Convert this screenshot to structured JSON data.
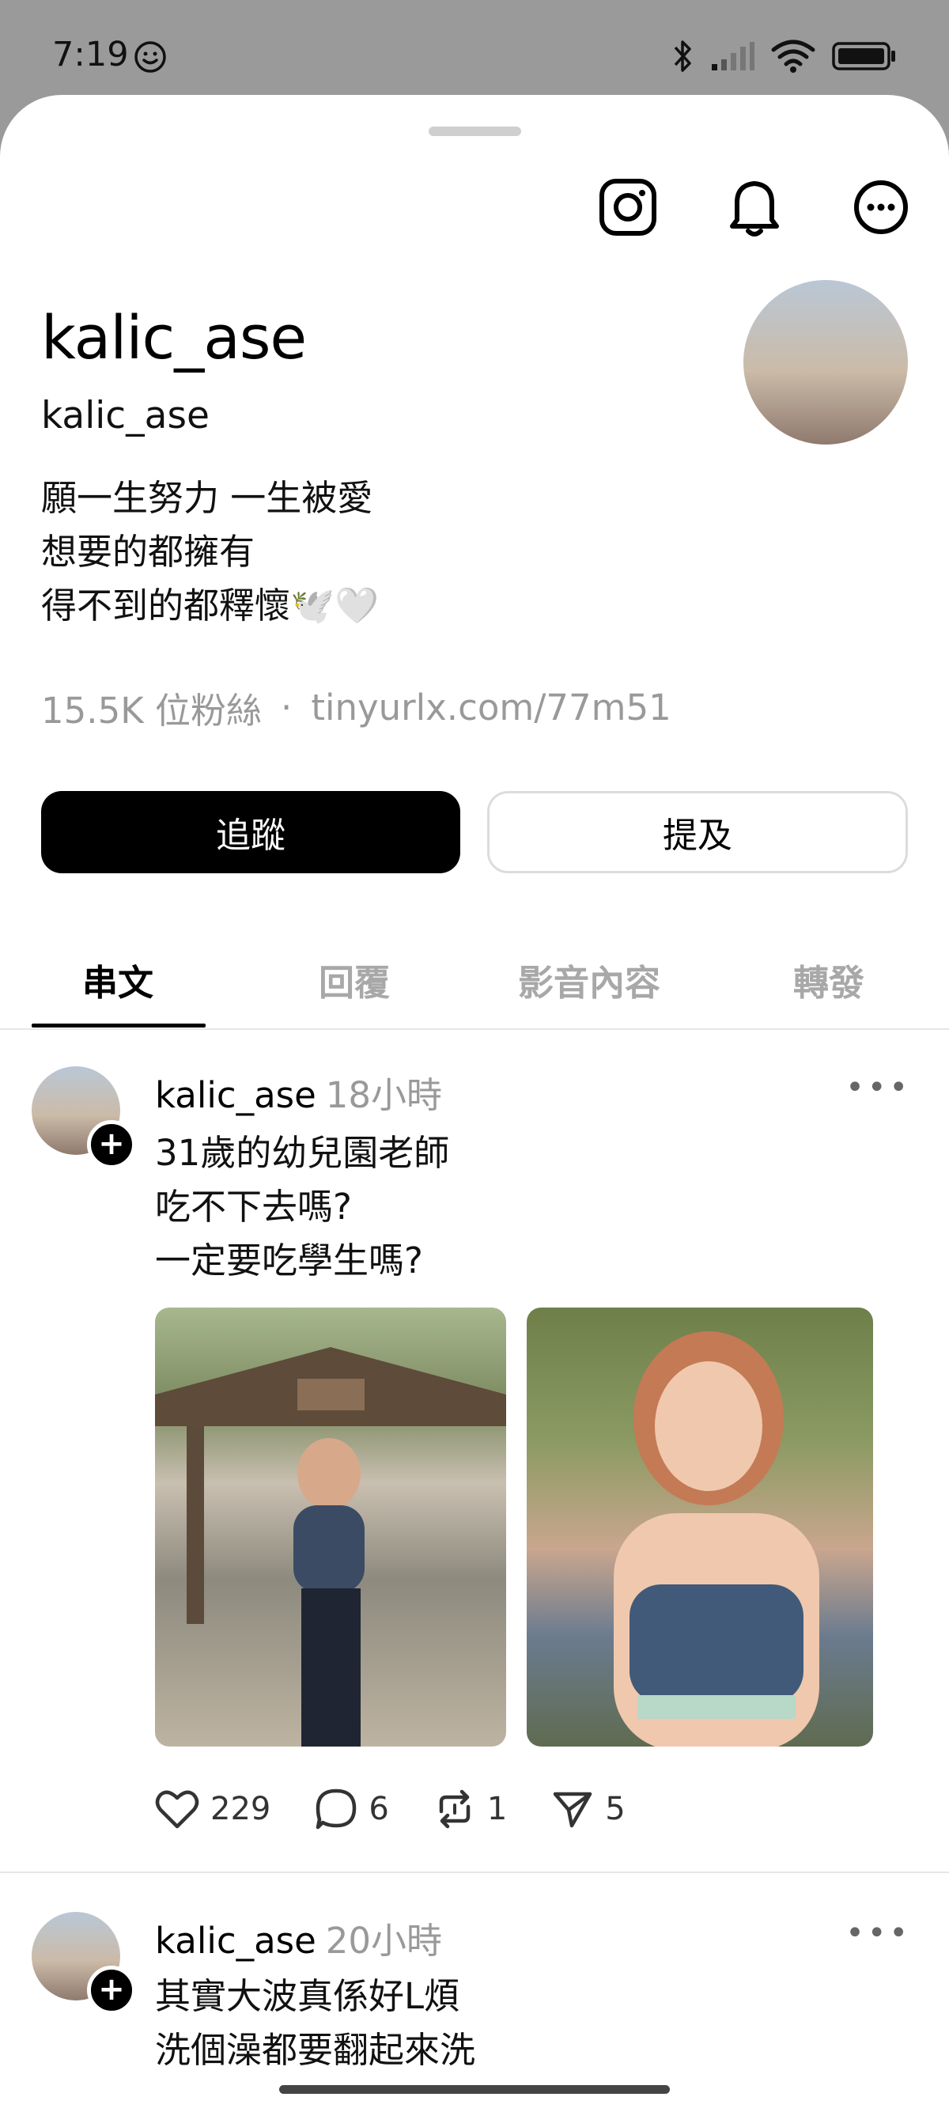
{
  "status_bar": {
    "time": "7:19"
  },
  "profile": {
    "name": "kalic_ase",
    "handle": "kalic_ase",
    "bio": [
      "願一生努力 一生被愛",
      "想要的都擁有",
      "得不到的都釋懷🕊️🤍"
    ],
    "followers": "15.5K 位粉絲",
    "separator": "·",
    "link": "tinyurlx.com/77m51"
  },
  "buttons": {
    "follow": "追蹤",
    "mention": "提及"
  },
  "tabs": [
    "串文",
    "回覆",
    "影音內容",
    "轉發"
  ],
  "posts": [
    {
      "user": "kalic_ase",
      "time": "18小時",
      "text": [
        "31歲的幼兒園老師",
        "吃不下去嗎?",
        "一定要吃學生嗎?"
      ],
      "likes": "229",
      "comments": "6",
      "reposts": "1",
      "shares": "5"
    },
    {
      "user": "kalic_ase",
      "time": "20小時",
      "text": [
        "其實大波真係好L煩",
        "洗個澡都要翻起來洗"
      ]
    }
  ]
}
